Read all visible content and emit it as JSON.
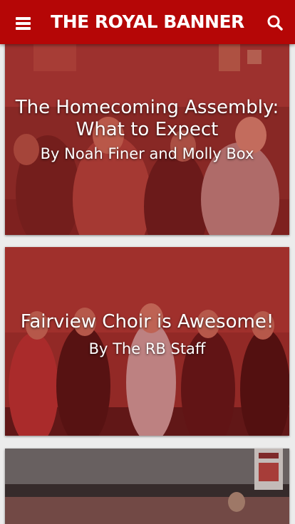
{
  "header": {
    "title": "THE ROYAL BANNER",
    "menu_icon": "hamburger-menu-icon",
    "search_icon": "search-icon",
    "background": "#b50606"
  },
  "stories": [
    {
      "headline": "The Homecoming Assembly: What to Expect",
      "byline": "By Noah Finer and Molly Box"
    },
    {
      "headline": "Fairview Choir is Awesome!",
      "byline": "By The RB Staff"
    },
    {
      "headline": "",
      "byline": ""
    }
  ],
  "colors": {
    "brand_red": "#b50606",
    "page_background": "#ececec"
  }
}
